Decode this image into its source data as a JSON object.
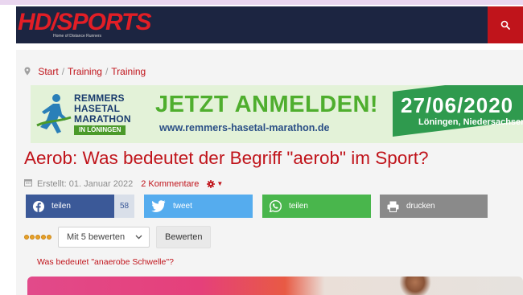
{
  "header": {
    "logo_text": "HD/SPORTS",
    "logo_subtext": "Home of Distance Runners",
    "search_icon": "search-icon",
    "colors": {
      "nav_bg": "#1c2541",
      "search_bg": "#c0141b",
      "logo": "#e21e26"
    }
  },
  "breadcrumb": {
    "pin_icon": "map-marker-icon",
    "items": [
      "Start",
      "Training",
      "Training"
    ]
  },
  "banner": {
    "logo_lines": [
      "REMMERS",
      "HASETAL",
      "MARATHON"
    ],
    "logo_location": "IN LÖNINGEN",
    "headline": "JETZT ANMELDEN!",
    "url": "www.remmers-hasetal-marathon.de",
    "date": "27/06/2020",
    "place": "Löningen, Niedersachsen",
    "colors": {
      "bg": "#e3f2d8",
      "headline": "#4fae2e",
      "date_box": "#2f9a4e"
    }
  },
  "article": {
    "title": "Aerob: Was bedeutet der Begriff \"aerob\" im Sport?",
    "created": "Erstellt: 01. Januar 2022",
    "comments": "2 Kommentare",
    "calendar_icon": "calendar-icon",
    "gear_icon": "gear-icon"
  },
  "share": {
    "facebook": {
      "label": "teilen",
      "count": "58",
      "icon": "facebook-icon",
      "color": "#3b5998"
    },
    "twitter": {
      "label": "tweet",
      "icon": "twitter-icon",
      "color": "#55acee"
    },
    "whatsapp": {
      "label": "teilen",
      "icon": "whatsapp-icon",
      "color": "#49b64c"
    },
    "print": {
      "label": "drucken",
      "icon": "printer-icon",
      "color": "#8a8a8a"
    }
  },
  "rating": {
    "stars": 5,
    "select_value": "Mit 5 bewerten",
    "button_label": "Bewerten"
  },
  "related": {
    "link": "Was bedeutet \"anaerobe Schwelle\"?"
  }
}
